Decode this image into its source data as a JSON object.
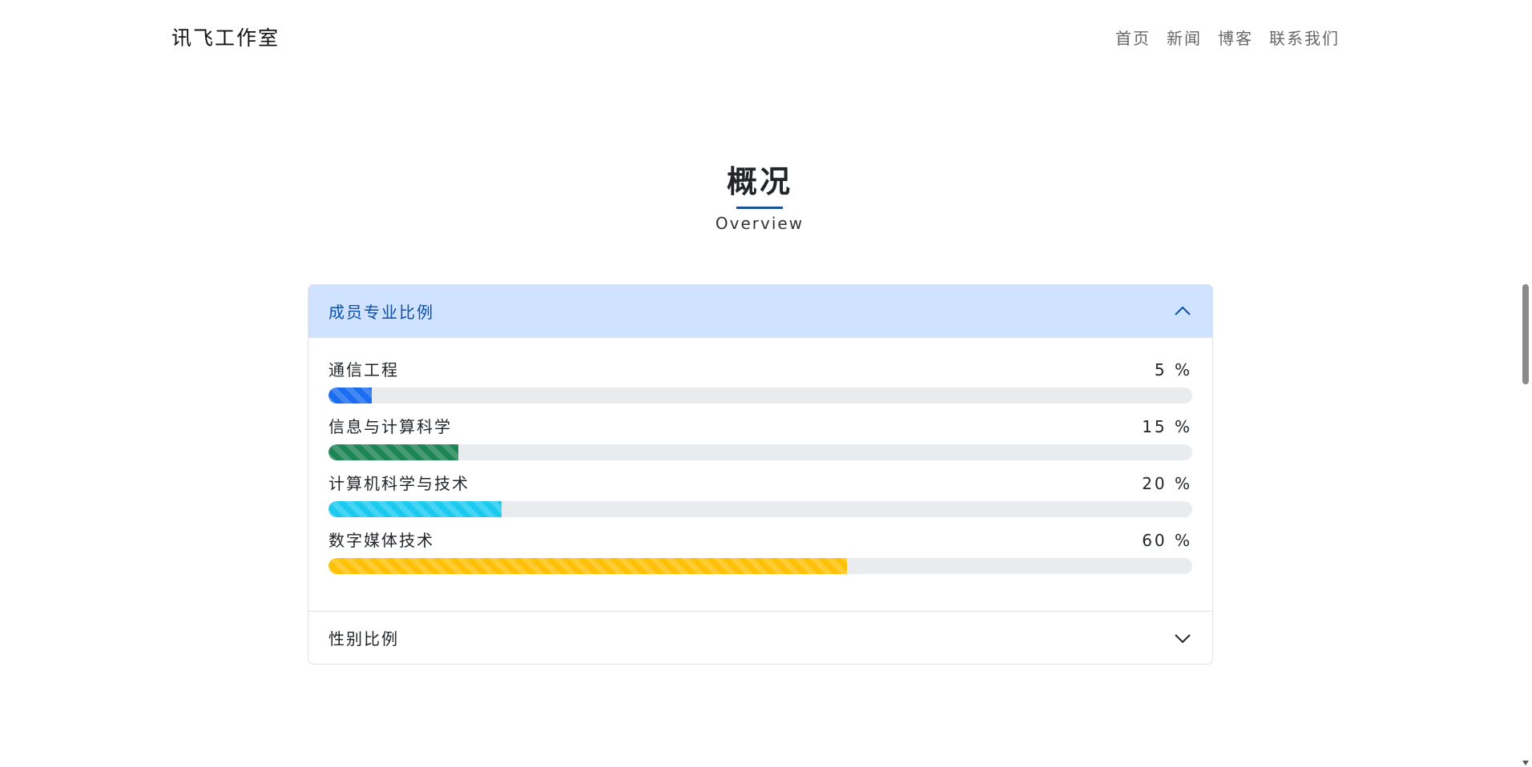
{
  "brand": "讯飞工作室",
  "nav": {
    "items": [
      "首页",
      "新闻",
      "博客",
      "联系我们"
    ]
  },
  "section": {
    "title": "概况",
    "subtitle": "Overview"
  },
  "accordion": {
    "panels": [
      {
        "title": "成员专业比例",
        "expanded": true,
        "chevron_icon": "chevron-up-icon",
        "items": [
          {
            "label": "通信工程",
            "percent_text": "5 %",
            "value": 5,
            "color": "#1a6cf0"
          },
          {
            "label": "信息与计算科学",
            "percent_text": "15 %",
            "value": 15,
            "color": "#1e8555"
          },
          {
            "label": "计算机科学与技术",
            "percent_text": "20 %",
            "value": 20,
            "color": "#1ccaf0"
          },
          {
            "label": "数字媒体技术",
            "percent_text": "60 %",
            "value": 60,
            "color": "#ffc107"
          }
        ]
      },
      {
        "title": "性别比例",
        "expanded": false,
        "chevron_icon": "chevron-down-icon"
      }
    ]
  },
  "colors": {
    "accent": "#1c4f9c",
    "open_header_bg": "#cfe2ff",
    "open_header_text": "#0c4fa8",
    "track": "#e9ecef"
  }
}
